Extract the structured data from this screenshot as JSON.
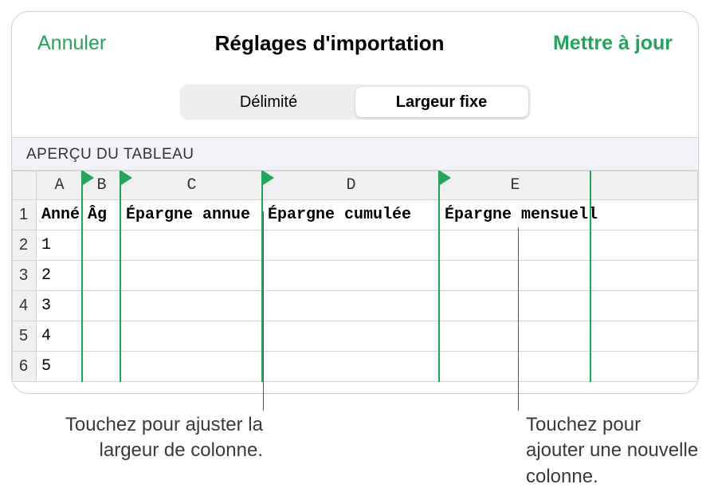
{
  "header": {
    "cancel": "Annuler",
    "title": "Réglages d'importation",
    "confirm": "Mettre à jour"
  },
  "segmented": {
    "delimited": "Délimité",
    "fixed": "Largeur fixe"
  },
  "section": {
    "preview": "APERÇU DU TABLEAU"
  },
  "columns": [
    "A",
    "B",
    "C",
    "D",
    "E"
  ],
  "header_row": [
    "Anné",
    "Âg",
    "Épargne annue",
    "Épargne cumulée",
    "Épargne mensuell"
  ],
  "data_rows": [
    {
      "num": "1"
    },
    {
      "num": "2",
      "a": "1"
    },
    {
      "num": "3",
      "a": "2"
    },
    {
      "num": "4",
      "a": "3"
    },
    {
      "num": "5",
      "a": "4"
    },
    {
      "num": "6",
      "a": "5"
    }
  ],
  "callouts": {
    "adjust": "Touchez pour ajuster la largeur de colonne.",
    "add": "Touchez pour ajouter une nouvelle colonne."
  }
}
